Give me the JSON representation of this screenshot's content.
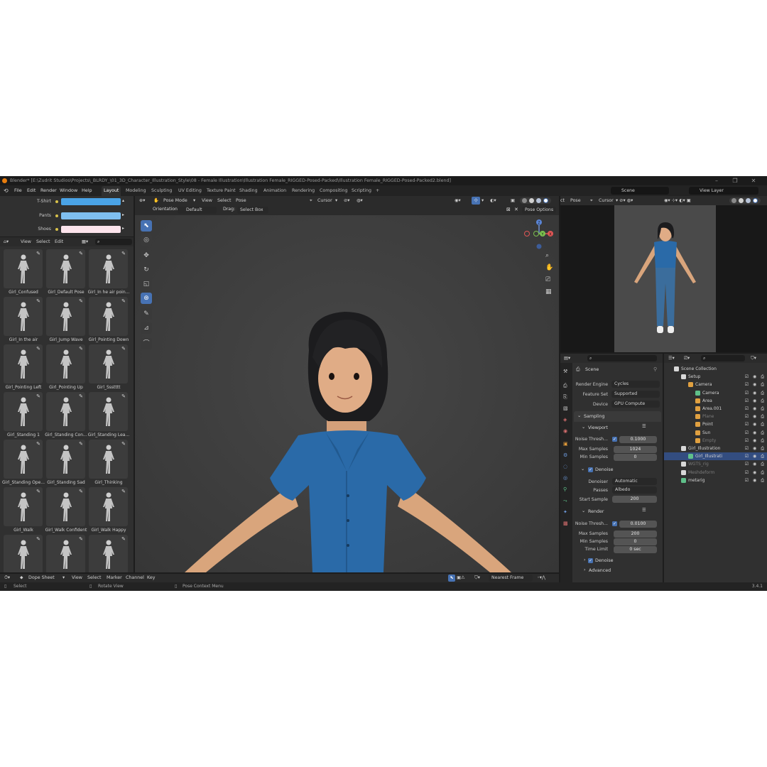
{
  "window": {
    "title": "Blender* [E:\\Zudrit Studios\\Projects\\_BLRDY_\\01_3D_Character_Illustration_Style\\08 - Female Illustration\\Illustration Female_RIGGED-Posed-Packed\\Illustration Female_RIGGED-Posed-Packed2.blend]",
    "controls": [
      "–",
      "❐",
      "✕"
    ]
  },
  "menubar": {
    "menus": [
      "File",
      "Edit",
      "Render",
      "Window",
      "Help"
    ],
    "workspaces": [
      "Layout",
      "Modeling",
      "Sculpting",
      "UV Editing",
      "Texture Paint",
      "Shading",
      "Animation",
      "Rendering",
      "Compositing",
      "Scripting"
    ],
    "active_workspace": "Layout",
    "add_tab": "+",
    "scene": "Scene",
    "view_layer": "View Layer"
  },
  "colors_panel": {
    "items": [
      {
        "label": "T-Shirt",
        "color": "#4aa3e6"
      },
      {
        "label": "Pants",
        "color": "#7fbff0"
      },
      {
        "label": "Shoes",
        "color": "#fde4ec"
      }
    ]
  },
  "asset_browser": {
    "menus": [
      "View",
      "Select",
      "Edit"
    ],
    "assets": [
      "Girl_Confused",
      "Girl_Default Pose",
      "Girl_In he air poin...",
      "Girl_In the air",
      "Girl_Jump Wave",
      "Girl_Pointing Down",
      "Girl_Pointing Left",
      "Girl_Pointing Up",
      "Girl_Ssstttt",
      "Girl_Standing 1",
      "Girl_Standing Con...",
      "Girl_Standing Lea...",
      "Girl_Standing Ope...",
      "Girl_Standing Sad",
      "Girl_Thinking",
      "Girl_Walk",
      "Girl_Walk Confident",
      "Girl_Walk Happy",
      "",
      "",
      ""
    ]
  },
  "viewport": {
    "mode": "Pose Mode",
    "menus": [
      "View",
      "Select",
      "Pose"
    ],
    "orientation_label": "Orientation:",
    "orientation": "Default",
    "drag_label": "Drag:",
    "drag": "Select Box",
    "pivot": "Cursor",
    "pose_options": "Pose Options",
    "gizmo": {
      "x": "X",
      "y": "Y",
      "z": "Z"
    }
  },
  "render_preview": {
    "menus": [
      "ct",
      "Pose"
    ],
    "pivot": "Cursor"
  },
  "properties": {
    "context": "Scene",
    "render_engine_label": "Render Engine",
    "render_engine": "Cycles",
    "feature_set_label": "Feature Set",
    "feature_set": "Supported",
    "device_label": "Device",
    "device": "GPU Compute",
    "sampling": "Sampling",
    "viewport_section": "Viewport",
    "noise_label": "Noise Thresh...",
    "viewport_noise": "0.1000",
    "max_samples_label": "Max Samples",
    "viewport_max_samples": "1024",
    "min_samples_label": "Min Samples",
    "viewport_min_samples": "0",
    "denoise": "Denoise",
    "denoiser_label": "Denoiser",
    "denoiser": "Automatic",
    "passes_label": "Passes",
    "passes": "Albedo",
    "start_sample_label": "Start Sample",
    "start_sample": "200",
    "render_section": "Render",
    "render_noise": "0.0100",
    "render_max_samples": "200",
    "render_min_samples": "0",
    "time_limit_label": "Time Limit",
    "time_limit": "0 sec",
    "advanced": "Advanced"
  },
  "outliner": {
    "rows": [
      {
        "label": "Scene Collection",
        "indent": 0,
        "icon": "collection-icon"
      },
      {
        "label": "Setup",
        "indent": 1,
        "icon": "collection-icon"
      },
      {
        "label": "Camera",
        "indent": 2,
        "icon": "camera-icon"
      },
      {
        "label": "Camera",
        "indent": 3,
        "icon": "camera-data-icon"
      },
      {
        "label": "Area",
        "indent": 3,
        "icon": "light-icon"
      },
      {
        "label": "Area.001",
        "indent": 3,
        "icon": "light-icon"
      },
      {
        "label": "Plane",
        "indent": 3,
        "icon": "mesh-icon"
      },
      {
        "label": "Point",
        "indent": 3,
        "icon": "light-icon"
      },
      {
        "label": "Sun",
        "indent": 3,
        "icon": "light-icon"
      },
      {
        "label": "Empty",
        "indent": 3,
        "icon": "empty-icon"
      },
      {
        "label": "Girl_Illustration",
        "indent": 1,
        "icon": "collection-icon"
      },
      {
        "label": "Girl_Illustrati",
        "indent": 2,
        "icon": "armature-icon"
      },
      {
        "label": "WGTS_rig",
        "indent": 1,
        "icon": "collection-icon"
      },
      {
        "label": "Meshdeform",
        "indent": 1,
        "icon": "collection-icon"
      },
      {
        "label": "metarig",
        "indent": 1,
        "icon": "armature-icon"
      }
    ]
  },
  "dope_sheet": {
    "mode": "Dope Sheet",
    "menus": [
      "View",
      "Select",
      "Marker",
      "Channel",
      "Key"
    ],
    "snapping": "Nearest Frame"
  },
  "statusbar": {
    "select": "Select",
    "rotate": "Rotate View",
    "context": "Pose Context Menu",
    "version": "3.4.1"
  }
}
